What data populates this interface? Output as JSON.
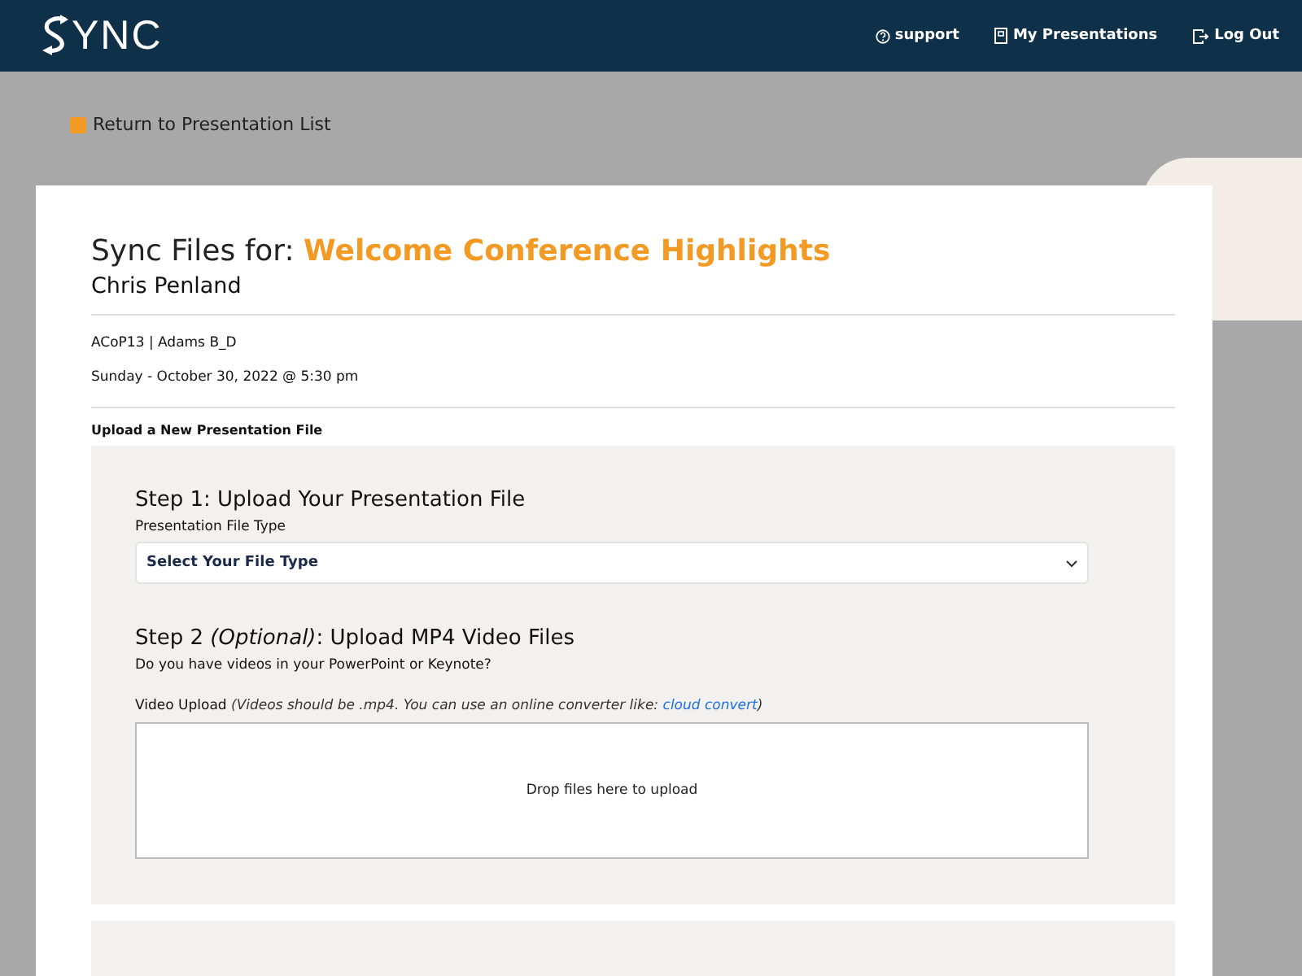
{
  "header": {
    "logo": "YNC",
    "nav": [
      {
        "kind": "help",
        "label": "support"
      },
      {
        "kind": "doc",
        "label": "My Presentations"
      },
      {
        "kind": "logout",
        "label": "Log Out"
      }
    ]
  },
  "back_link": "Return to Presentation List",
  "card": {
    "title": "Sync Files for: **Welcome Conference Highlights**",
    "presenter": "Chris Penland",
    "session": "ACoP13 | Adams B_D",
    "datetime": "Sunday - October 30, 2022 @ 5:30 pm",
    "section_label": "Upload a New Presentation File",
    "step1": {
      "heading": "Step 1: Upload Your Presentation File",
      "field_label": "Presentation File Type",
      "select": "Select Your File Type"
    },
    "step2": {
      "heading": "Step 2 *(Optional)*: Upload MP4 Video Files",
      "question": "Do you have videos in your PowerPoint or Keynote?",
      "upload_label": "Video Upload",
      "note_before": "(Videos should be .mp4. You can use an online converter like:",
      "link": "cloud convert",
      "note_after": ")",
      "dropzone": "Drop files here to upload"
    }
  }
}
